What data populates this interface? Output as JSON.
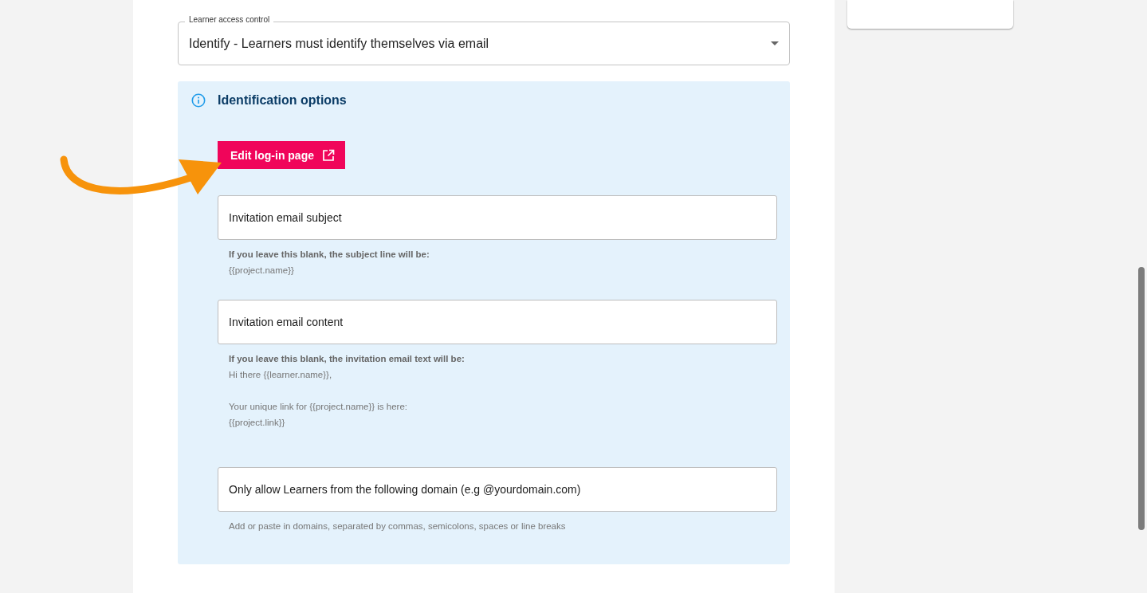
{
  "access_control": {
    "label": "Learner access control",
    "value": "Identify - Learners must identify themselves via email"
  },
  "identification": {
    "title": "Identification options",
    "button": "Edit log-in page",
    "fields": [
      {
        "placeholder": "Invitation email subject",
        "helper_title": "If you leave this blank, the subject line will be:",
        "paragraphs": [
          [
            "{{project.name}}"
          ]
        ]
      },
      {
        "placeholder": "Invitation email content",
        "helper_title": "If you leave this blank, the invitation email text will be:",
        "paragraphs": [
          [
            "Hi there {{learner.name}},"
          ],
          [
            "Your unique link for {{project.name}} is here:",
            "{{project.link}}"
          ]
        ]
      },
      {
        "placeholder": "Only allow Learners from the following domain (e.g @yourdomain.com)",
        "paragraphs": [
          [
            "Add or paste in domains, separated by commas, semicolons, spaces or line breaks"
          ]
        ]
      }
    ]
  }
}
